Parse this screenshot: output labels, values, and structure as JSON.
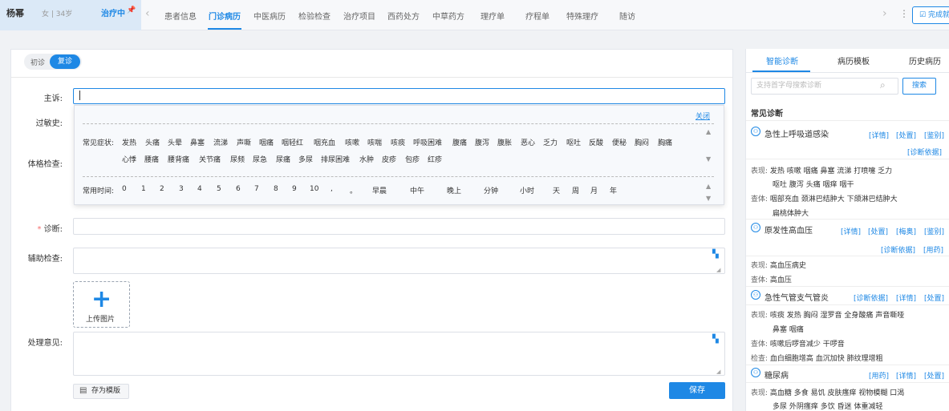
{
  "header": {
    "patient_name": "杨幂",
    "patient_info": "女 | 34岁",
    "status": "治疗中",
    "tabs": [
      "患者信息",
      "门诊病历",
      "中医病历",
      "检验检查",
      "治疗项目",
      "西药处方",
      "中草药方",
      "理疗单",
      "疗程单",
      "特殊理疗",
      "随访"
    ],
    "active_tab": "门诊病历",
    "done_label": "完成就"
  },
  "visit_toggle": {
    "first": "初诊",
    "return": "复诊",
    "selected": "复诊"
  },
  "form": {
    "chief_complaint_label": "主诉:",
    "allergy_label": "过敏史:",
    "physical_exam_label": "体格检查:",
    "diagnosis_label": "诊断:",
    "aux_exam_label": "辅助检查:",
    "treatment_label": "处理意见:",
    "upload_label": "上传图片",
    "save_template_label": "存为模版",
    "save_label": "保存"
  },
  "popup": {
    "close_label": "关闭",
    "symptoms_label": "常见症状:",
    "symptoms_row1": [
      "发热",
      "头痛",
      "头晕",
      "鼻塞",
      "流涕",
      "声嘶",
      "咽痛",
      "咽轻红",
      "咽充血",
      "咳嗽",
      "咳喘",
      "咳痰",
      "呼吸困难",
      "腹痛",
      "腹泻",
      "腹胀",
      "恶心",
      "乏力",
      "呕吐",
      "反酸",
      "便秘",
      "胸闷",
      "胸痛"
    ],
    "symptoms_row2": [
      "心悸",
      "腰痛",
      "腰背痛",
      "关节痛",
      "尿频",
      "尿急",
      "尿痛",
      "多尿",
      "排尿困难",
      "水肿",
      "皮疹",
      "包疹",
      "红疹"
    ],
    "time_label": "常用时间:",
    "time_items": [
      "0",
      "1",
      "2",
      "3",
      "4",
      "5",
      "6",
      "7",
      "8",
      "9",
      "10",
      ",",
      "。",
      "早晨",
      "中午",
      "晚上",
      "分钟",
      "小时",
      "天",
      "周",
      "月",
      "年"
    ]
  },
  "right_panel": {
    "tabs": [
      "智能诊断",
      "病历模板",
      "历史病历"
    ],
    "active_tab": "智能诊断",
    "search_placeholder": "支持首字母搜索诊断",
    "search_button": "搜索",
    "section_title": "常见诊断",
    "diagnoses": [
      {
        "name": "急性上呼吸道感染",
        "links_line1": [
          "[详情]",
          "[处置]",
          "[鉴别]"
        ],
        "links_line2": [
          "[诊断依据]"
        ],
        "rows": [
          [
            "表现:",
            "发热  咳嗽  咽痛  鼻塞  流涕  打喷嚏  乏力"
          ],
          [
            "",
            "呕吐  腹泻  头痛  咽痒  咽干"
          ],
          [
            "查体:",
            "咽部充血  颈淋巴结肿大  下颌淋巴结肿大"
          ],
          [
            "",
            "扁桃体肿大"
          ]
        ]
      },
      {
        "name": "原发性高血压",
        "links_line1": [
          "[详情]",
          "[处置]",
          "[梅奥]",
          "[鉴别]"
        ],
        "links_line2": [
          "[诊断依据]",
          "[用药]"
        ],
        "rows": [
          [
            "表现:",
            "高血压病史"
          ],
          [
            "查体:",
            "高血压"
          ]
        ]
      },
      {
        "name": "急性气管支气管炎",
        "links_line1": [
          "[诊断依据]",
          "[详情]",
          "[处置]"
        ],
        "links_line2": [],
        "rows": [
          [
            "表现:",
            "咳痰  发热  胸闷  湿罗音  全身酸痛  声音嘶哑"
          ],
          [
            "",
            "鼻塞  咽痛"
          ],
          [
            "查体:",
            "咳嗽后啰音减少  干啰音"
          ],
          [
            "检查:",
            "血白细胞增高  血沉加快  肺纹理增粗"
          ]
        ]
      },
      {
        "name": "糖尿病",
        "links_line1": [
          "[用药]",
          "[详情]",
          "[处置]"
        ],
        "links_line2": [],
        "rows": [
          [
            "表现:",
            "高血糖  多食  易饥  皮肤瘙痒  视物模糊  口渴"
          ],
          [
            "",
            "多尿  外阴瘙痒  多饮  昏迷  体重减轻"
          ]
        ]
      }
    ]
  }
}
